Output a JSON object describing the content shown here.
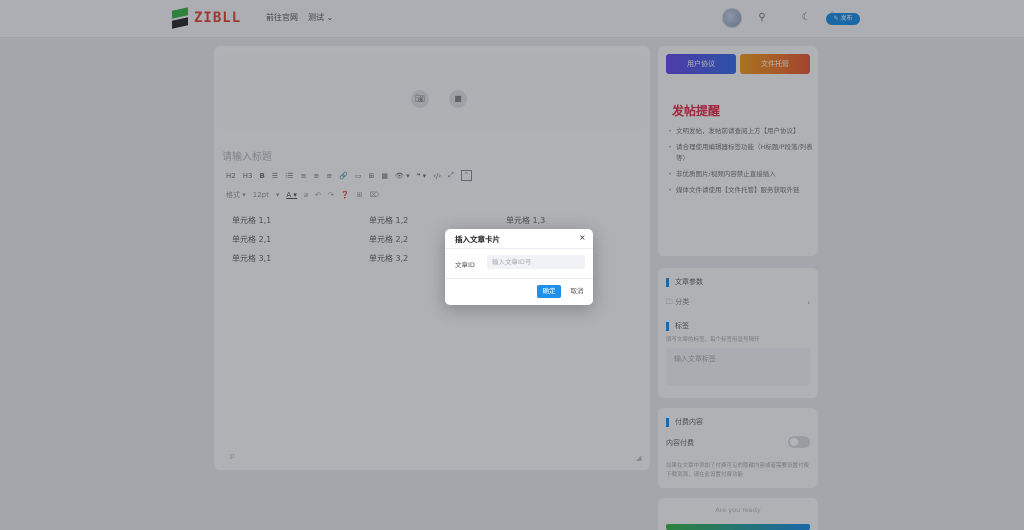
{
  "header": {
    "logo_text": "ZIBLL",
    "nav": [
      "前往官网",
      "测试 ⌄"
    ],
    "publish_label": "✎ 发布"
  },
  "editor": {
    "title_placeholder": "请输入标题",
    "toolbar_row1": [
      "H2",
      "H3",
      "B",
      "☰",
      "⁝☰",
      "≡",
      "≡",
      "≡",
      "🔗",
      "▭",
      "⊞",
      "▦",
      "👁 ▾",
      "❝ ▾",
      "‹/›",
      "⤢"
    ],
    "toolbar_row2": [
      "格式 ▾",
      "12pt",
      "▾",
      "A ▾",
      "⌀",
      "↶",
      "↷",
      "❓",
      "⊞",
      "⌦"
    ],
    "table": [
      [
        "单元格 1,1",
        "单元格 1,2",
        "单元格 1,3"
      ],
      [
        "单元格 2,1",
        "单元格 2,2",
        ""
      ],
      [
        "单元格 3,1",
        "单元格 3,2",
        ""
      ]
    ]
  },
  "sidebar": {
    "agreement_button": "用户协议",
    "hosting_button": "文件托管",
    "warning_title": "发帖提醒",
    "warnings": [
      "文明发帖，发帖前请查阅上方【用户协议】",
      "请合理使用编辑器标签功能（H标题/P段落/列表等）",
      "非优质图片/视频内容禁止直接插入",
      "媒体文件请使用【文件托管】服务获取外链"
    ],
    "params_title": "文章参数",
    "category_label": "分类",
    "tags_title": "标签",
    "tags_hint": "填写文章的标签，每个标签用逗号隔开",
    "tags_placeholder": "输入文章标签",
    "paid_title": "付费内容",
    "paid_toggle_label": "内容付费",
    "paid_hint": "如果在文章中添加了付费可见的隐藏内容或者需要设置付费下载资源，请在此设置付费功能",
    "ready_text": "Are you ready"
  },
  "modal": {
    "title": "插入文章卡片",
    "close_glyph": "×",
    "field_label": "文章ID",
    "field_placeholder": "输入文章ID号",
    "field_value": "",
    "ok_label": "确定",
    "cancel_label": "取消"
  },
  "colors": {
    "primary": "#1f8fe8",
    "warning_title": "#e0304a",
    "agreement_gradient": [
      "#6a4de8",
      "#3a6fe8"
    ],
    "hosting_gradient": [
      "#f0a020",
      "#e85a3a"
    ]
  }
}
